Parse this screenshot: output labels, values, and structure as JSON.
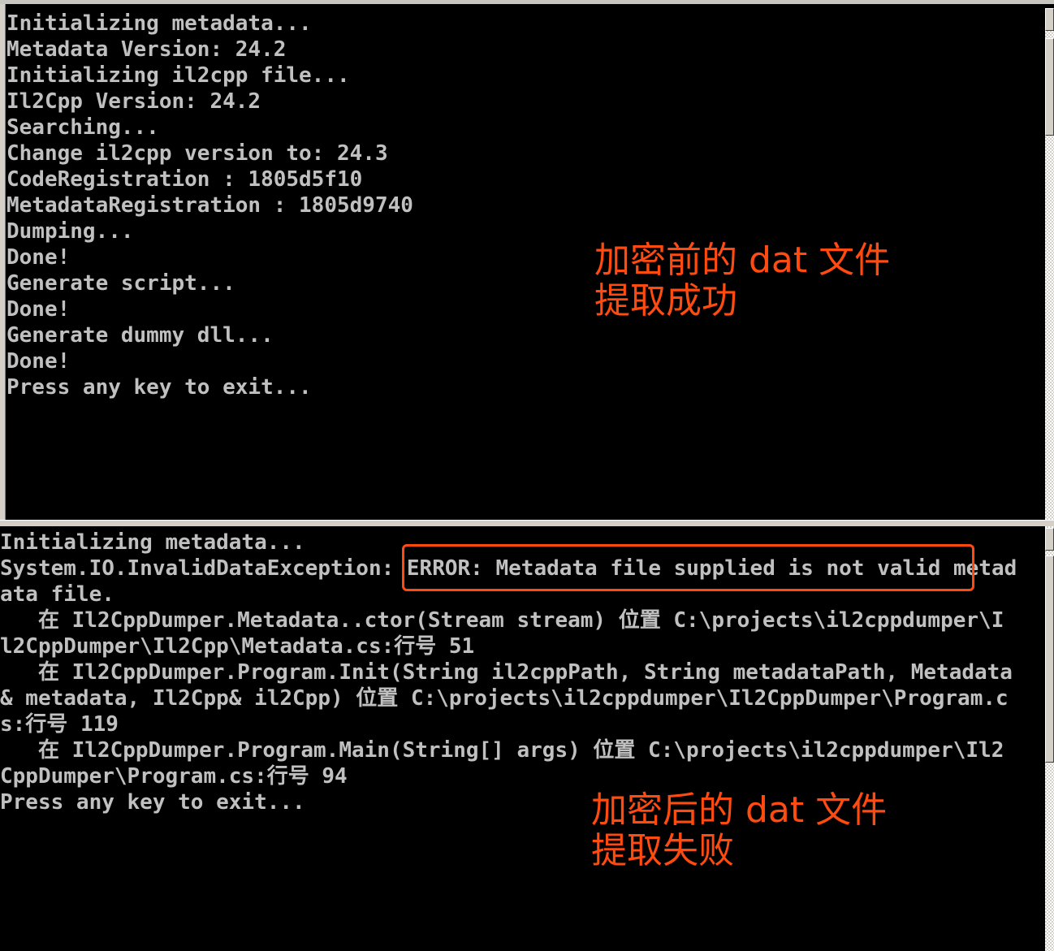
{
  "top_console": {
    "lines": [
      "Initializing metadata...",
      "Metadata Version: 24.2",
      "Initializing il2cpp file...",
      "Il2Cpp Version: 24.2",
      "Searching...",
      "Change il2cpp version to: 24.3",
      "CodeRegistration : 1805d5f10",
      "MetadataRegistration : 1805d9740",
      "Dumping...",
      "Done!",
      "Generate script...",
      "Done!",
      "Generate dummy dll...",
      "Done!",
      "Press any key to exit..."
    ],
    "annotation": [
      "加密前的 dat 文件",
      "提取成功"
    ]
  },
  "bottom_console": {
    "lines": [
      "Initializing metadata...",
      "System.IO.InvalidDataException: ERROR: Metadata file supplied is not valid metad",
      "ata file.",
      "   在 Il2CppDumper.Metadata..ctor(Stream stream) 位置 C:\\projects\\il2cppdumper\\I",
      "l2CppDumper\\Il2Cpp\\Metadata.cs:行号 51",
      "   在 Il2CppDumper.Program.Init(String il2cppPath, String metadataPath, Metadata",
      "& metadata, Il2Cpp& il2Cpp) 位置 C:\\projects\\il2cppdumper\\Il2CppDumper\\Program.c",
      "s:行号 119",
      "   在 Il2CppDumper.Program.Main(String[] args) 位置 C:\\projects\\il2cppdumper\\Il2",
      "CppDumper\\Program.cs:行号 94",
      "Press any key to exit..."
    ],
    "highlighted_text": "ERROR: Metadata file supplied is not valid",
    "annotation": [
      "加密后的 dat 文件",
      "提取失败"
    ]
  },
  "colors": {
    "annotation": "#ff4a10",
    "console_bg": "#000000",
    "console_text": "#c0c0c0"
  }
}
